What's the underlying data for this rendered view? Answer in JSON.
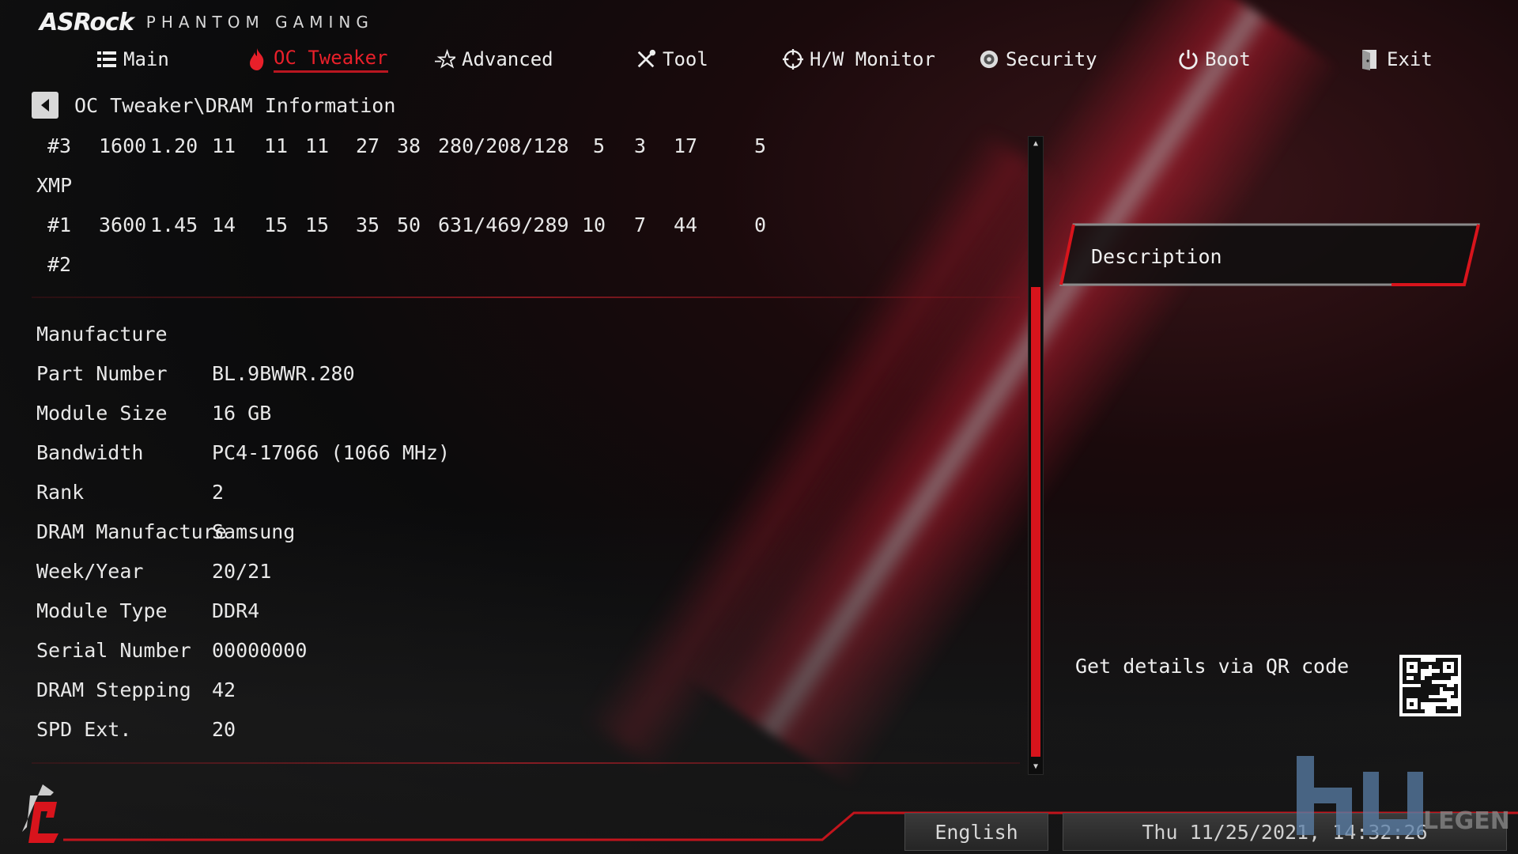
{
  "brand": {
    "logo": "ASRock",
    "subtitle": "PHANTOM GAMING"
  },
  "nav": [
    {
      "label": "Main",
      "icon": "list-icon"
    },
    {
      "label": "OC Tweaker",
      "icon": "flame-icon",
      "active": true
    },
    {
      "label": "Advanced",
      "icon": "star-icon"
    },
    {
      "label": "Tool",
      "icon": "tools-icon"
    },
    {
      "label": "H/W Monitor",
      "icon": "crosshair-icon"
    },
    {
      "label": "Security",
      "icon": "shield-icon"
    },
    {
      "label": "Boot",
      "icon": "power-icon"
    },
    {
      "label": "Exit",
      "icon": "exit-door-icon"
    }
  ],
  "breadcrumb": "OC Tweaker\\DRAM Information",
  "timing_rows": [
    {
      "id": "#3",
      "c": [
        "1600",
        "1.20",
        "11",
        "11",
        "11",
        "27",
        "38",
        "280/208/128",
        "5",
        "3",
        "17",
        "5"
      ]
    },
    {
      "id": "XMP",
      "c": []
    },
    {
      "id": "#1",
      "c": [
        "3600",
        "1.45",
        "14",
        "15",
        "15",
        "35",
        "50",
        "631/469/289",
        "10",
        "7",
        "44",
        "0"
      ]
    },
    {
      "id": "#2",
      "c": []
    }
  ],
  "info": [
    {
      "label": "Manufacture",
      "value": ""
    },
    {
      "label": "Part Number",
      "value": "BL.9BWWR.280"
    },
    {
      "label": "Module Size",
      "value": "16 GB"
    },
    {
      "label": "Bandwidth",
      "value": "PC4-17066 (1066 MHz)"
    },
    {
      "label": "Rank",
      "value": "2"
    },
    {
      "label": "DRAM Manufacture",
      "value": "Samsung"
    },
    {
      "label": "Week/Year",
      "value": "20/21"
    },
    {
      "label": "Module Type",
      "value": "DDR4"
    },
    {
      "label": "Serial Number",
      "value": "00000000"
    },
    {
      "label": "DRAM Stepping",
      "value": "42"
    },
    {
      "label": "SPD Ext.",
      "value": "20"
    }
  ],
  "description": {
    "title": "Description",
    "qr_text": "Get details via QR code"
  },
  "footer": {
    "language": "English",
    "datetime": "Thu 11/25/2021, 14:32:26"
  },
  "watermark": {
    "text": "LEGEND"
  },
  "colors": {
    "accent": "#e8202a",
    "scroll": "#d8141c"
  }
}
